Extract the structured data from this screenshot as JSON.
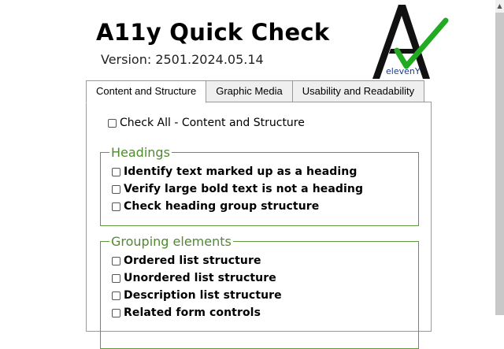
{
  "header": {
    "title": "A11y Quick Check",
    "version": "Version: 2501.2024.05.14",
    "logo_text": "elevenY"
  },
  "tabs": [
    {
      "label": "Content and Structure",
      "active": true
    },
    {
      "label": "Graphic Media",
      "active": false
    },
    {
      "label": "Usability and Readability",
      "active": false
    }
  ],
  "panel": {
    "check_all_label": "Check All - Content and Structure",
    "groups": [
      {
        "legend": "Headings",
        "items": [
          "Identify text marked up as a heading",
          "Verify large bold text is not a heading",
          "Check heading group structure"
        ]
      },
      {
        "legend": "Grouping elements",
        "items": [
          "Ordered list structure",
          "Unordered list structure",
          "Description list structure",
          "Related form controls"
        ]
      }
    ]
  },
  "colors": {
    "accent_green": "#4e8a2e",
    "check_green": "#22aa22",
    "logo_blue": "#1a3a8a"
  }
}
